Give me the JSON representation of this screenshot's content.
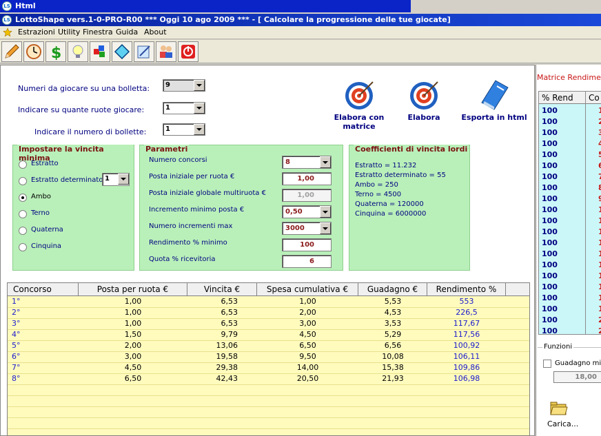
{
  "window1": {
    "title": "Html"
  },
  "window2": {
    "title": "LottoShape vers.1-0-PRO-R00   ***   Oggi 10 ago 2009   ***    - [ Calcolare la progressione delle tue giocate]"
  },
  "menu": [
    "Estrazioni",
    "Utility",
    "Finestra",
    "Guida",
    "About"
  ],
  "toolbar_icons": [
    "pencil-icon",
    "clock-icon",
    "dollar-icon",
    "bulb-icon",
    "colors-icon",
    "shape-icon",
    "notebook-icon",
    "users-icon",
    "power-icon"
  ],
  "form": {
    "numeri_label": "Numeri da giocare su una bolletta:",
    "numeri_value": "9",
    "ruote_label": "Indicare su quante ruote giocare:",
    "ruote_value": "1",
    "bollette_label": "Indicare il numero di bollette:",
    "bollette_value": "1"
  },
  "actions": {
    "matrice": "Elabora con matrice",
    "elabora": "Elabora",
    "esporta": "Esporta in html"
  },
  "vincita": {
    "title": "Impostare la vincita minima",
    "options": [
      "Estratto",
      "Estratto determinato",
      "Ambo",
      "Terno",
      "Quaterna",
      "Cinquina"
    ],
    "selected": "Ambo",
    "estratto_det_value": "1"
  },
  "parametri": {
    "title": "Parametri",
    "rows": [
      {
        "label": "Numero concorsi",
        "value": "8",
        "type": "combo"
      },
      {
        "label": "Posta iniziale per ruota €",
        "value": "1,00",
        "type": "input"
      },
      {
        "label": "Posta iniziale globale multiruota €",
        "value": "1,00",
        "type": "disabled"
      },
      {
        "label": "Incremento minimo posta €",
        "value": "0,50",
        "type": "combo"
      },
      {
        "label": "Numero incrementi max",
        "value": "3000",
        "type": "combo"
      },
      {
        "label": "Rendimento % minimo",
        "value": "100",
        "type": "input"
      },
      {
        "label": "Quota % ricevitoria",
        "value": "6",
        "type": "input"
      }
    ]
  },
  "coefficienti": {
    "title": "Coefficienti di vincita lordi",
    "lines": [
      "Estratto =  11.232",
      "Estratto determinato =  55",
      "Ambo =  250",
      "Terno =  4500",
      "Quaterna =  120000",
      "Cinquina =  6000000"
    ]
  },
  "table": {
    "headers": [
      "Concorso",
      "Posta  per ruota €",
      "Vincita €",
      "Spesa cumulativa €",
      "Guadagno €",
      "Rendimento %"
    ],
    "rows": [
      [
        "1°",
        "1,00",
        "6,53",
        "1,00",
        "5,53",
        "553"
      ],
      [
        "2°",
        "1,00",
        "6,53",
        "2,00",
        "4,53",
        "226,5"
      ],
      [
        "3°",
        "1,00",
        "6,53",
        "3,00",
        "3,53",
        "117,67"
      ],
      [
        "4°",
        "1,50",
        "9,79",
        "4,50",
        "5,29",
        "117,56"
      ],
      [
        "5°",
        "2,00",
        "13,06",
        "6,50",
        "6,56",
        "100,92"
      ],
      [
        "6°",
        "3,00",
        "19,58",
        "9,50",
        "10,08",
        "106,11"
      ],
      [
        "7°",
        "4,50",
        "29,38",
        "14,00",
        "15,38",
        "109,86"
      ],
      [
        "8°",
        "6,50",
        "42,43",
        "20,50",
        "21,93",
        "106,98"
      ]
    ]
  },
  "matrice": {
    "title": "Matrice Rendimen",
    "headers": [
      "% Rend",
      "Co"
    ],
    "rend": [
      "100",
      "100",
      "100",
      "100",
      "100",
      "100",
      "100",
      "100",
      "100",
      "100",
      "100",
      "100",
      "100",
      "100",
      "100",
      "100",
      "100",
      "100",
      "100",
      "100",
      "100"
    ],
    "co": [
      "1",
      "2",
      "3",
      "4",
      "5",
      "6",
      "7",
      "8",
      "9",
      "1",
      "1",
      "1",
      "1",
      "1",
      "1",
      "1",
      "1",
      "1",
      "1",
      "2",
      "2"
    ]
  },
  "funzioni": {
    "title": "Funzioni",
    "guadagno_label": "Guadagno min",
    "guadagno_value": "18,00",
    "carica_label": "Carica..."
  }
}
